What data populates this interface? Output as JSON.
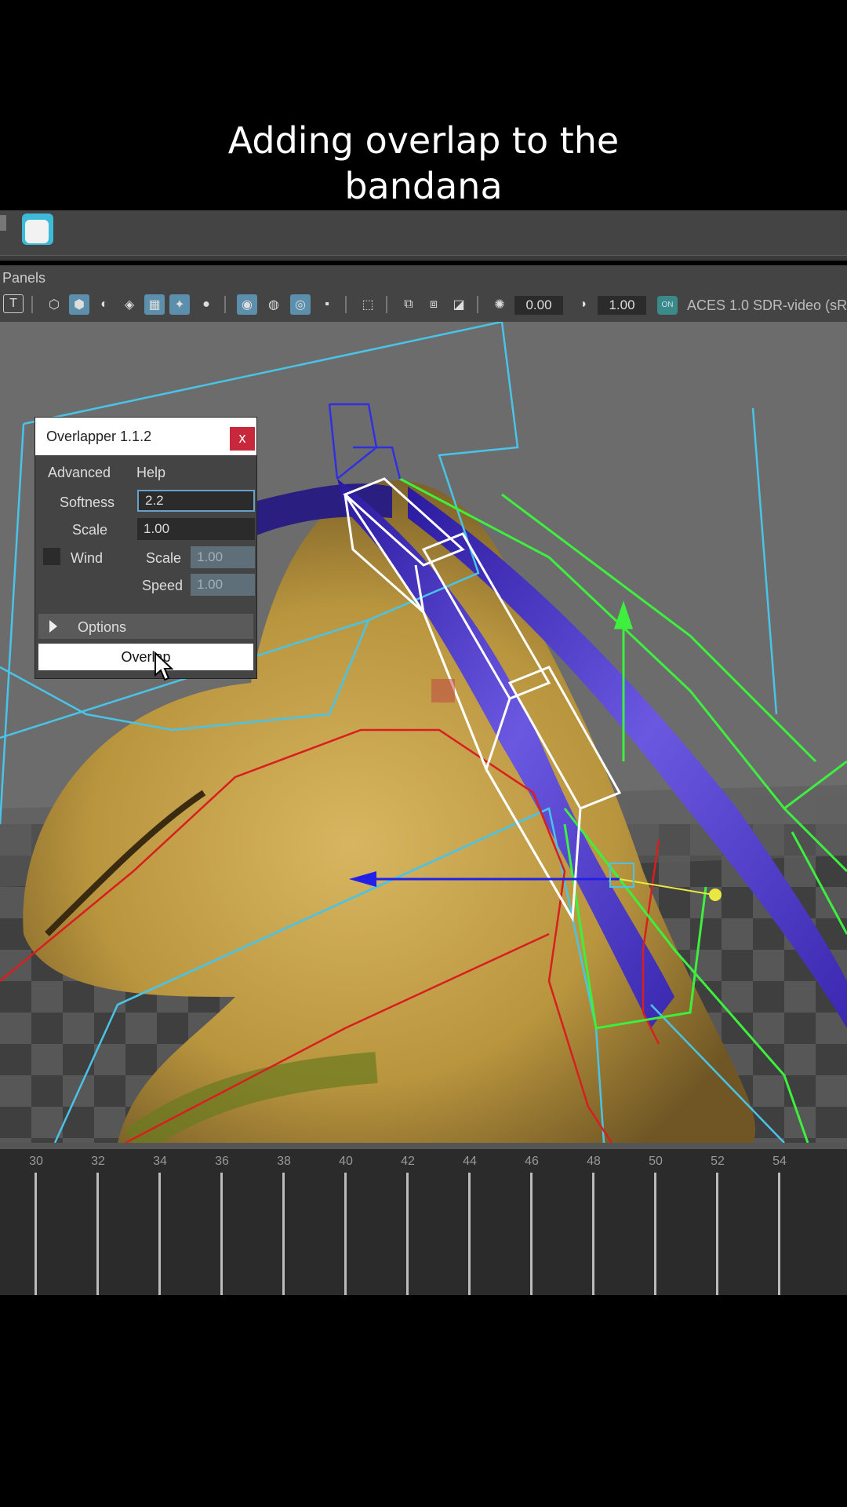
{
  "caption": {
    "line1": "Adding overlap to the",
    "line2": "bandana"
  },
  "panel_menu": {
    "label": "Panels"
  },
  "toolbar": {
    "field1": "0.00",
    "field2": "1.00",
    "colorspace": "ACES 1.0 SDR-video (sR",
    "colorspace_icon": "on-icon"
  },
  "dialog": {
    "title": "Overlapper 1.1.2",
    "close": "x",
    "menu_advanced": "Advanced",
    "menu_help": "Help",
    "softness_label": "Softness",
    "softness_value": "2.2",
    "scale_label": "Scale",
    "scale_value": "1.00",
    "wind_label": "Wind",
    "wind_scale_label": "Scale",
    "wind_scale_value": "1.00",
    "wind_speed_label": "Speed",
    "wind_speed_value": "1.00",
    "options_label": "Options",
    "overlap_button": "Overlap"
  },
  "timeline": {
    "frames": [
      "30",
      "32",
      "34",
      "36",
      "38",
      "40",
      "42",
      "44",
      "46",
      "48",
      "50",
      "52",
      "54"
    ]
  }
}
